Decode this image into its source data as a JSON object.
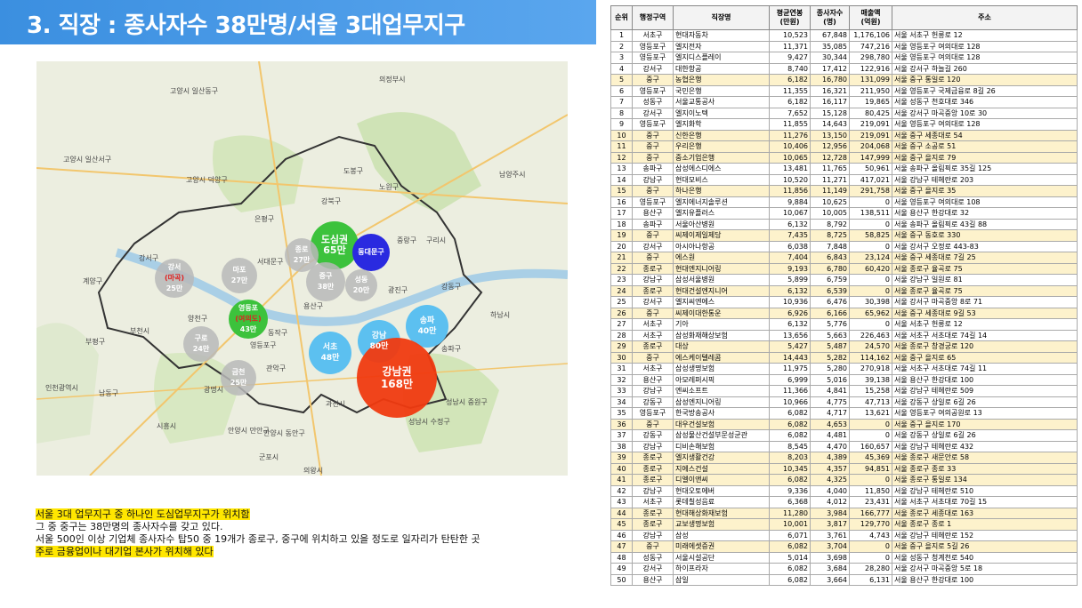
{
  "title": "3. 직장 : 종사자수 38만명/서울 3대업무지구",
  "map": {
    "bubbles": [
      {
        "line1": "도심권",
        "line2": "65만",
        "color": "#3cc23c"
      },
      {
        "line1": "동대문구",
        "line2": "",
        "color": "#2a2ae0"
      },
      {
        "line1": "강서",
        "line2": "(마곡)",
        "line3": "25만",
        "color": "#b8b8b8"
      },
      {
        "line1": "마포",
        "line2": "27만",
        "color": "#b8b8b8"
      },
      {
        "line1": "종로",
        "line2": "27만",
        "color": "#b8b8b8"
      },
      {
        "line1": "중구",
        "line2": "38만",
        "color": "#b8b8b8"
      },
      {
        "line1": "성동",
        "line2": "20만",
        "color": "#b8b8b8"
      },
      {
        "line1": "영등포",
        "line2": "(여의도)",
        "line3": "43만",
        "color": "#3cc23c"
      },
      {
        "line1": "구로",
        "line2": "24만",
        "color": "#b8b8b8"
      },
      {
        "line1": "금천",
        "line2": "25만",
        "color": "#b8b8b8"
      },
      {
        "line1": "서초",
        "line2": "48만",
        "color": "#5cc0f0"
      },
      {
        "line1": "강남",
        "line2": "80만",
        "color": "#5cc0f0"
      },
      {
        "line1": "송파",
        "line2": "40만",
        "color": "#5cc0f0"
      },
      {
        "line1": "강남권",
        "line2": "168만",
        "color": "#f03a10"
      }
    ],
    "labels": [
      "고양시 일산동구",
      "고양시 일산서구",
      "고양시 덕양구",
      "의정부시",
      "남양주시",
      "도봉구",
      "노원구",
      "은평구",
      "강북구",
      "서대문구",
      "중랑구",
      "구리시",
      "강서구",
      "양천구",
      "계양구",
      "부천시",
      "영등포구",
      "동작구",
      "관악구",
      "광진구",
      "강동구",
      "하남시",
      "광명시",
      "과천시",
      "성남시 수정구",
      "성남시 중원구",
      "안양시 만안구",
      "안양시 동안구",
      "군포시",
      "시흥시",
      "의왕시",
      "부평구",
      "남동구",
      "인천광역시",
      "송파구",
      "용산구"
    ]
  },
  "notes": {
    "line1": "서울 3대 업무지구 중 하나인 도심업무지구가 위치함",
    "line2": "그 중 중구는 38만명의 종사자수를 갖고 있다.",
    "line3": "서울 500인 이상 기업체 종사자수 탑50 중 19개가 종로구, 중구에 위치하고 있을 정도로 일자리가 탄탄한 곳",
    "line4": "주로 금융업이나 대기업 본사가 위치해 있다"
  },
  "table": {
    "headers": [
      "순위",
      "행정구역",
      "직장명",
      "평균연봉\n(만원)",
      "종사자수\n(명)",
      "매출액\n(억원)",
      "주소"
    ],
    "rows": [
      [
        "1",
        "서초구",
        "현대자동차",
        "10,523",
        "67,848",
        "1,176,106",
        "서울 서초구 헌릉로 12",
        false
      ],
      [
        "2",
        "영등포구",
        "엘지전자",
        "11,371",
        "35,085",
        "747,216",
        "서울 영등포구 여의대로 128",
        false
      ],
      [
        "3",
        "영등포구",
        "엘지디스플레이",
        "9,427",
        "30,344",
        "298,780",
        "서울 영등포구 여의대로 128",
        false
      ],
      [
        "4",
        "강서구",
        "대한항공",
        "8,740",
        "17,412",
        "122,916",
        "서울 강서구 하늘길 260",
        false
      ],
      [
        "5",
        "중구",
        "농협은행",
        "6,182",
        "16,780",
        "131,099",
        "서울 중구 통일로 120",
        true
      ],
      [
        "6",
        "영등포구",
        "국민은행",
        "11,355",
        "16,321",
        "211,950",
        "서울 영등포구 국제금융로 8길 26",
        false
      ],
      [
        "7",
        "성동구",
        "서울교통공사",
        "6,182",
        "16,117",
        "19,865",
        "서울 성동구 천호대로 346",
        false
      ],
      [
        "8",
        "강서구",
        "엘지이노텍",
        "7,652",
        "15,128",
        "80,425",
        "서울 강서구 마곡중앙 10로 30",
        false
      ],
      [
        "9",
        "영등포구",
        "엘지화학",
        "11,855",
        "14,643",
        "219,091",
        "서울 영등포구 여의대로 128",
        false
      ],
      [
        "10",
        "중구",
        "신한은행",
        "11,276",
        "13,150",
        "219,091",
        "서울 중구 세종대로 54",
        true
      ],
      [
        "11",
        "중구",
        "우리은행",
        "10,406",
        "12,956",
        "204,068",
        "서울 중구 소공로 51",
        true
      ],
      [
        "12",
        "중구",
        "중소기업은행",
        "10,065",
        "12,728",
        "147,999",
        "서울 중구 을지로 79",
        true
      ],
      [
        "13",
        "송파구",
        "삼성에스디에스",
        "13,481",
        "11,765",
        "50,961",
        "서울 송파구 올림픽로 35길 125",
        false
      ],
      [
        "14",
        "강남구",
        "현대모비스",
        "10,520",
        "11,271",
        "417,021",
        "서울 강남구 테헤란로 203",
        false
      ],
      [
        "15",
        "중구",
        "하나은행",
        "11,856",
        "11,149",
        "291,758",
        "서울 중구 을지로 35",
        true
      ],
      [
        "16",
        "영등포구",
        "엘지에너지솔루션",
        "9,884",
        "10,625",
        "0",
        "서울 영등포구 여의대로 108",
        false
      ],
      [
        "17",
        "용산구",
        "엘지유플러스",
        "10,067",
        "10,005",
        "138,511",
        "서울 용산구 한강대로 32",
        false
      ],
      [
        "18",
        "송파구",
        "서울아산병원",
        "6,132",
        "8,792",
        "0",
        "서울 송파구 올림픽로 43길 88",
        false
      ],
      [
        "19",
        "중구",
        "씨제이제일제당",
        "7,435",
        "8,725",
        "58,825",
        "서울 중구 동호로 330",
        true
      ],
      [
        "20",
        "강서구",
        "아시아나항공",
        "6,038",
        "7,848",
        "0",
        "서울 강서구 오정로 443-83",
        false
      ],
      [
        "21",
        "중구",
        "에스원",
        "7,404",
        "6,843",
        "23,124",
        "서울 중구 세종대로 7길 25",
        true
      ],
      [
        "22",
        "종로구",
        "현대엔지니어링",
        "9,193",
        "6,780",
        "60,420",
        "서울 종로구 율곡로 75",
        true
      ],
      [
        "23",
        "강남구",
        "삼성서울병원",
        "5,899",
        "6,759",
        "0",
        "서울 강남구 일원로 81",
        false
      ],
      [
        "24",
        "종로구",
        "현대건설엔지니어",
        "6,132",
        "6,539",
        "0",
        "서울 종로구 율곡로 75",
        true
      ],
      [
        "25",
        "강서구",
        "엘지씨엔에스",
        "10,936",
        "6,476",
        "30,398",
        "서울 강서구 마곡중앙 8로 71",
        false
      ],
      [
        "26",
        "중구",
        "씨제이대한통운",
        "6,926",
        "6,166",
        "65,962",
        "서울 중구 세종대로 9길 53",
        true
      ],
      [
        "27",
        "서초구",
        "기아",
        "6,132",
        "5,776",
        "0",
        "서울 서초구 헌릉로 12",
        false
      ],
      [
        "28",
        "서초구",
        "삼성화재해상보험",
        "13,656",
        "5,663",
        "226,463",
        "서울 서초구 서초대로 74길 14",
        false
      ],
      [
        "29",
        "종로구",
        "대상",
        "5,427",
        "5,487",
        "24,570",
        "서울 종로구 창경궁로 120",
        true
      ],
      [
        "30",
        "중구",
        "에스케이텔레콤",
        "14,443",
        "5,282",
        "114,162",
        "서울 중구 을지로 65",
        true
      ],
      [
        "31",
        "서초구",
        "삼성생명보험",
        "11,975",
        "5,280",
        "270,918",
        "서울 서초구 서초대로 74길 11",
        false
      ],
      [
        "32",
        "용산구",
        "아모레퍼시픽",
        "6,999",
        "5,016",
        "39,138",
        "서울 용산구 한강대로 100",
        false
      ],
      [
        "33",
        "강남구",
        "엔씨소프트",
        "11,366",
        "4,841",
        "15,258",
        "서울 강남구 테헤란로 509",
        false
      ],
      [
        "34",
        "강동구",
        "삼성엔지니어링",
        "10,966",
        "4,775",
        "47,713",
        "서울 강동구 상일로 6길 26",
        false
      ],
      [
        "35",
        "영등포구",
        "한국방송공사",
        "6,082",
        "4,717",
        "13,621",
        "서울 영등포구 여의공원로 13",
        false
      ],
      [
        "36",
        "중구",
        "대우건설보험",
        "6,082",
        "4,653",
        "0",
        "서울 중구 을지로 170",
        true
      ],
      [
        "37",
        "강동구",
        "삼성물산건설부문성균관",
        "6,082",
        "4,481",
        "0",
        "서울 강동구 상일로 6길 26",
        false
      ],
      [
        "38",
        "강남구",
        "디비손해보험",
        "8,545",
        "4,470",
        "160,657",
        "서울 강남구 테헤란로 432",
        false
      ],
      [
        "39",
        "종로구",
        "엘지생활건강",
        "8,203",
        "4,389",
        "45,369",
        "서울 종로구 새문안로 58",
        true
      ],
      [
        "40",
        "종로구",
        "지에스건설",
        "10,345",
        "4,357",
        "94,851",
        "서울 종로구 종로 33",
        true
      ],
      [
        "41",
        "종로구",
        "디엘이앤씨",
        "6,082",
        "4,325",
        "0",
        "서울 종로구 통일로 134",
        true
      ],
      [
        "42",
        "강남구",
        "현대오토에버",
        "9,336",
        "4,040",
        "11,850",
        "서울 강남구 테헤란로 510",
        false
      ],
      [
        "43",
        "서초구",
        "롯데칠성음료",
        "6,368",
        "4,012",
        "23,431",
        "서울 서초구 서초대로 70길 15",
        false
      ],
      [
        "44",
        "종로구",
        "현대해상화재보험",
        "11,280",
        "3,984",
        "166,777",
        "서울 종로구 세종대로 163",
        true
      ],
      [
        "45",
        "종로구",
        "교보생명보험",
        "10,001",
        "3,817",
        "129,770",
        "서울 종로구 종로 1",
        true
      ],
      [
        "46",
        "강남구",
        "삼성",
        "6,071",
        "3,761",
        "4,743",
        "서울 강남구 테헤란로 152",
        false
      ],
      [
        "47",
        "중구",
        "미래에셋증권",
        "6,082",
        "3,704",
        "0",
        "서울 중구 을지로 5길 26",
        true
      ],
      [
        "48",
        "성동구",
        "서울시설공단",
        "5,014",
        "3,698",
        "0",
        "서울 성동구 청계천로 540",
        false
      ],
      [
        "49",
        "강서구",
        "하이프라자",
        "6,082",
        "3,684",
        "28,280",
        "서울 강서구 마곡중앙 5로 18",
        false
      ],
      [
        "50",
        "용산구",
        "삼일",
        "6,082",
        "3,664",
        "6,131",
        "서울 용산구 한강대로 100",
        false
      ]
    ]
  }
}
